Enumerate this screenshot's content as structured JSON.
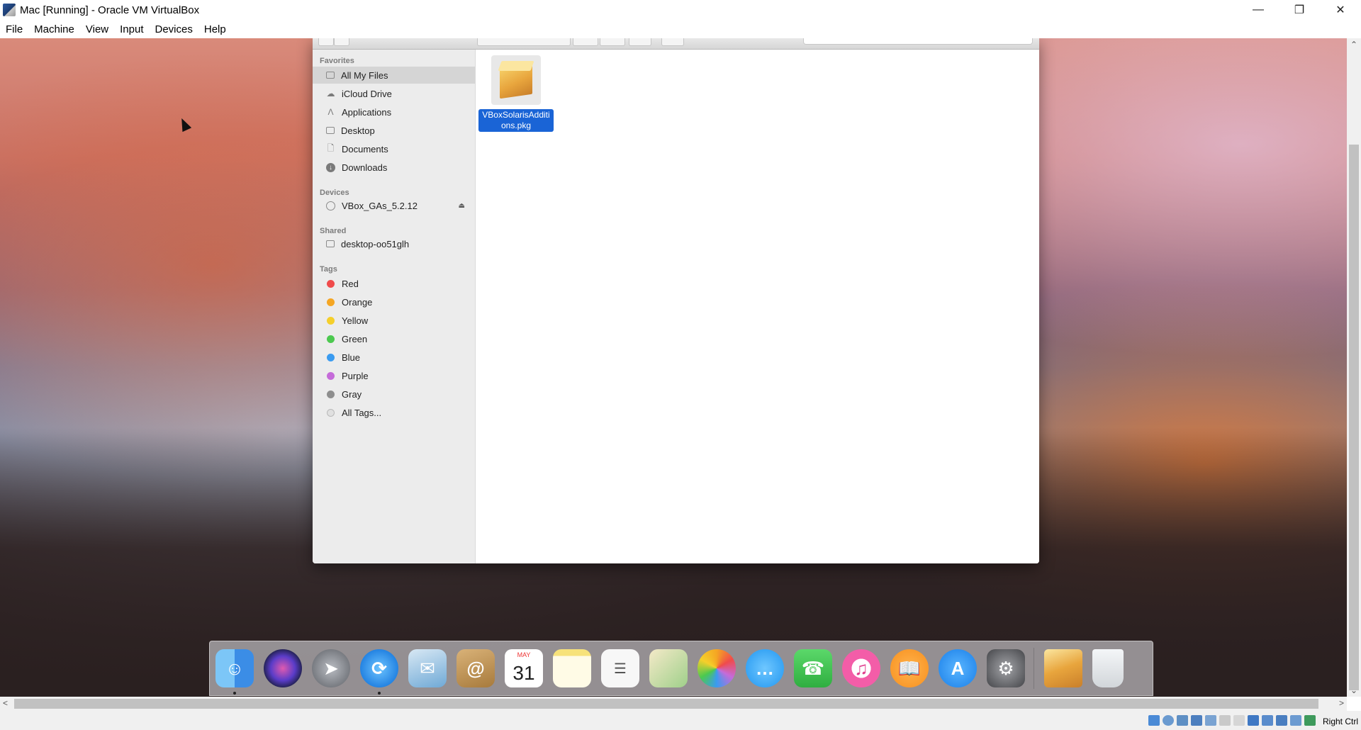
{
  "window": {
    "title": "Mac [Running] - Oracle VM VirtualBox"
  },
  "menubar": {
    "items": [
      "File",
      "Machine",
      "View",
      "Input",
      "Devices",
      "Help"
    ]
  },
  "finder": {
    "sidebar": {
      "favorites_label": "Favorites",
      "favorites": [
        "All My Files",
        "iCloud Drive",
        "Applications",
        "Desktop",
        "Documents",
        "Downloads"
      ],
      "devices_label": "Devices",
      "devices": [
        "VBox_GAs_5.2.12"
      ],
      "shared_label": "Shared",
      "shared": [
        "desktop-oo51glh"
      ],
      "tags_label": "Tags",
      "tags": [
        {
          "name": "Red",
          "color": "#f04b4b"
        },
        {
          "name": "Orange",
          "color": "#f5a623"
        },
        {
          "name": "Yellow",
          "color": "#f5cf2b"
        },
        {
          "name": "Green",
          "color": "#4cc94f"
        },
        {
          "name": "Blue",
          "color": "#3a9bf0"
        },
        {
          "name": "Purple",
          "color": "#c56bd9"
        },
        {
          "name": "Gray",
          "color": "#8e8e8e"
        },
        {
          "name": "All Tags...",
          "color": "#e0e0e0"
        }
      ]
    },
    "files": [
      {
        "name": "VBoxSolarisAdditions.pkg",
        "selected": true
      }
    ]
  },
  "dock": {
    "apps": [
      {
        "name": "Finder",
        "icon": "finder-icon",
        "color": "#4aa8f0",
        "running": true
      },
      {
        "name": "Siri",
        "icon": "siri-icon",
        "color": "#2b2f6b",
        "running": false
      },
      {
        "name": "Launchpad",
        "icon": "rocket-icon",
        "color": "#8b8f96",
        "running": false
      },
      {
        "name": "Safari",
        "icon": "compass-icon",
        "color": "#1f8ef0",
        "running": true
      },
      {
        "name": "Mail",
        "icon": "eagle-icon",
        "color": "#6fa9d6",
        "running": false
      },
      {
        "name": "Contacts",
        "icon": "contacts-icon",
        "color": "#c4954f",
        "running": false
      },
      {
        "name": "Calendar",
        "icon": "calendar-icon",
        "color": "#ffffff",
        "running": false,
        "month": "MAY",
        "day": "31"
      },
      {
        "name": "Notes",
        "icon": "notes-icon",
        "color": "#f7e27a",
        "running": false
      },
      {
        "name": "Reminders",
        "icon": "reminders-icon",
        "color": "#f5f5f5",
        "running": false
      },
      {
        "name": "Maps",
        "icon": "maps-icon",
        "color": "#9fd08a",
        "running": false
      },
      {
        "name": "Photos",
        "icon": "photos-icon",
        "color": "#f3f3f3",
        "running": false
      },
      {
        "name": "Messages",
        "icon": "messages-icon",
        "color": "#35a9f5",
        "running": false
      },
      {
        "name": "FaceTime",
        "icon": "facetime-icon",
        "color": "#3ec74f",
        "running": false
      },
      {
        "name": "iTunes",
        "icon": "itunes-icon",
        "color": "#f35da8",
        "running": false
      },
      {
        "name": "iBooks",
        "icon": "ibooks-icon",
        "color": "#f7901e",
        "running": false
      },
      {
        "name": "App Store",
        "icon": "appstore-icon",
        "color": "#1a8ef5",
        "running": false
      },
      {
        "name": "System Preferences",
        "icon": "gear-icon",
        "color": "#6d6e72",
        "running": false
      }
    ],
    "extras": [
      {
        "name": "Package",
        "icon": "package-icon",
        "color": "#e8a53d"
      },
      {
        "name": "Trash",
        "icon": "trash-icon",
        "color": "#e6e9ec"
      }
    ]
  },
  "statusbar": {
    "host_key": "Right Ctrl"
  }
}
